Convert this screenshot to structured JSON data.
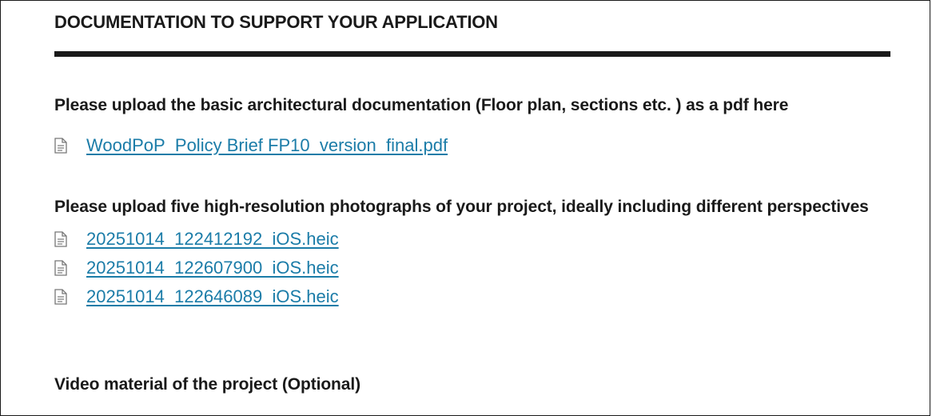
{
  "section": {
    "title": "DOCUMENTATION TO SUPPORT YOUR APPLICATION"
  },
  "questions": [
    {
      "label": "Please upload the basic architectural documentation (Floor plan, sections etc. ) as a pdf here",
      "files": [
        {
          "name": "WoodPoP_Policy Brief FP10_version_final.pdf",
          "icon": "file-icon"
        }
      ]
    },
    {
      "label": "Please upload five high-resolution photographs of your project, ideally including different perspectives",
      "files": [
        {
          "name": "20251014_122412192_iOS.heic",
          "icon": "file-icon"
        },
        {
          "name": "20251014_122607900_iOS.heic",
          "icon": "file-icon"
        },
        {
          "name": "20251014_122646089_iOS.heic",
          "icon": "file-icon"
        }
      ]
    },
    {
      "label": "Video material of the project (Optional)",
      "files": []
    }
  ],
  "colors": {
    "link": "#1b7ca8",
    "text": "#1a1a1a",
    "rule": "#1a1a1a"
  }
}
